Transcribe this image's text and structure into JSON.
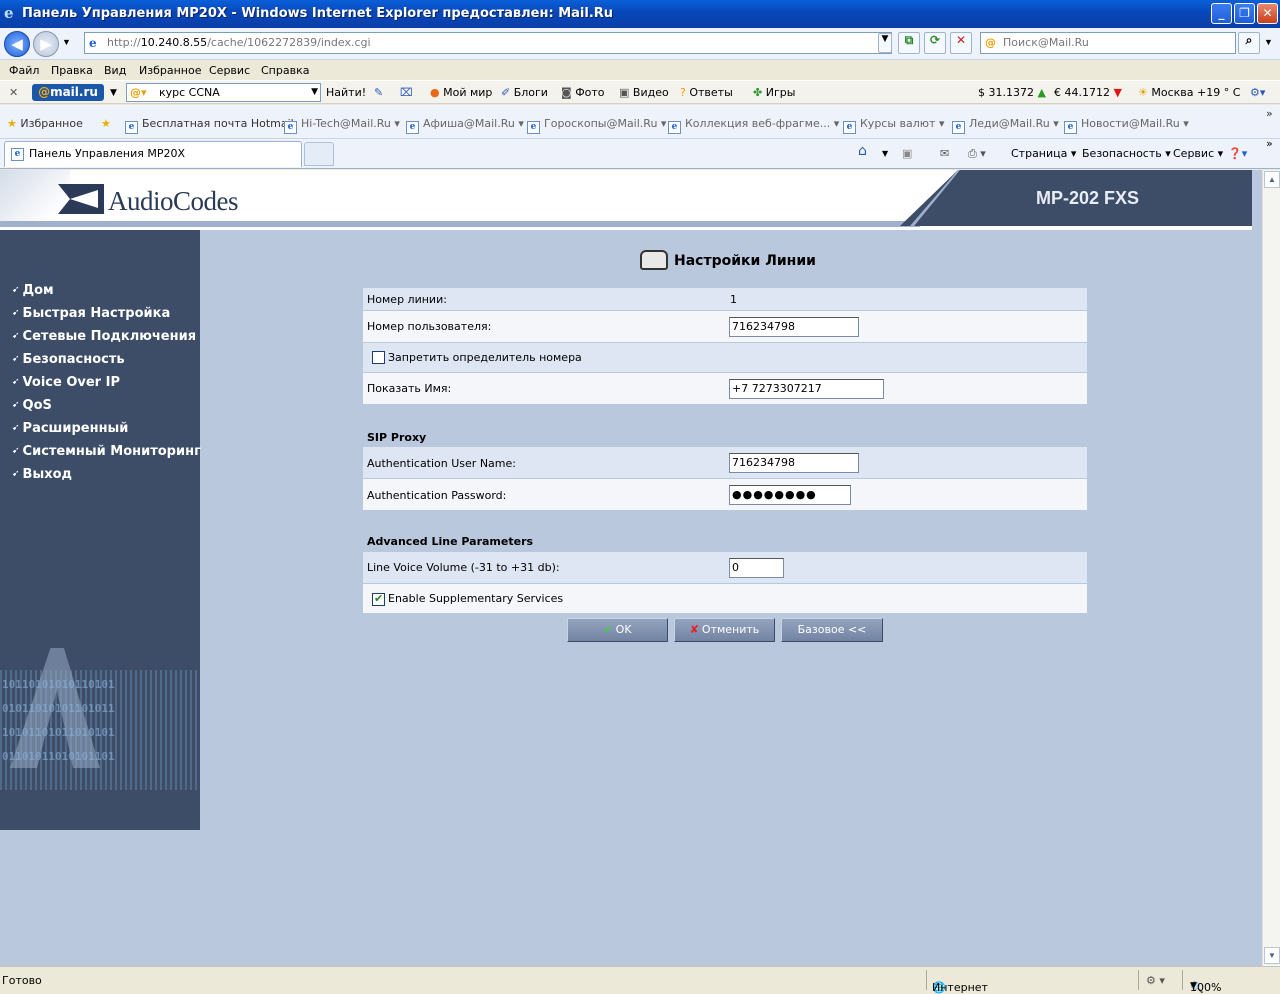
{
  "window": {
    "title": "Панель Управления MP20X - Windows Internet Explorer предоставлен: Mail.Ru"
  },
  "address": {
    "url_prefix": "http://",
    "url_host": "10.240.8.55",
    "url_path": "/cache/1062272839/index.cgi",
    "search_placeholder": "Поиск@Mail.Ru"
  },
  "menu": [
    "Файл",
    "Правка",
    "Вид",
    "Избранное",
    "Сервис",
    "Справка"
  ],
  "mailbar": {
    "logo_at": "@",
    "logo_text": "mail.ru",
    "search_value": "курс CCNA",
    "find": "Найти!",
    "items": [
      "Мой мир",
      "Блоги",
      "Фото",
      "Видео",
      "Ответы",
      "Игры"
    ],
    "usd": "$ 31.1372",
    "eur": "€ 44.1712",
    "weather": "Москва +19 ° C"
  },
  "favbar": {
    "favorites": "Избранное",
    "links": [
      "Бесплатная почта Hotmail",
      "Hi-Tech@Mail.Ru",
      "Афиша@Mail.Ru",
      "Гороскопы@Mail.Ru",
      "Коллекция веб-фрагме...",
      "Курсы валют",
      "Леди@Mail.Ru",
      "Новости@Mail.Ru"
    ]
  },
  "tabs": {
    "active": "Панель Управления MP20X",
    "commands": [
      "Страница",
      "Безопасность",
      "Сервис"
    ]
  },
  "header": {
    "logo": "AudioCodes",
    "model": "MP-202 FXS"
  },
  "sidebar": {
    "items": [
      "Дом",
      "Быстрая Настройка",
      "Сетевые Подключения",
      "Безопасность",
      "Voice Over IP",
      "QoS",
      "Расширенный",
      "Системный Мониторинг",
      "Выход"
    ],
    "deco_lines": [
      "10110101010110101",
      "01011010101101011",
      "10101101011010101",
      "01101011010101101"
    ]
  },
  "page": {
    "title": "Настройки Линии",
    "line_number_label": "Номер линии:",
    "line_number_value": "1",
    "user_number_label": "Номер пользователя:",
    "user_number_value": "716234798",
    "block_caller_id_label": "Запретить определитель номера",
    "block_caller_id": false,
    "display_name_label": "Показать Имя:",
    "display_name_value": "+7 7273307217",
    "sip_proxy_heading": "SIP Proxy",
    "auth_user_label": "Authentication User Name:",
    "auth_user_value": "716234798",
    "auth_pass_label": "Authentication Password:",
    "auth_pass_value": "●●●●●●●●",
    "advanced_heading": "Advanced Line Parameters",
    "volume_label": "Line Voice Volume (-31 to +31 db):",
    "volume_value": "0",
    "supp_services_label": "Enable Supplementary Services",
    "supp_services": true,
    "ok_mark": "✔",
    "ok_label": "OK",
    "cancel_mark": "✘",
    "cancel_label": "Отменить",
    "basic_label": "Базовое <<"
  },
  "status": {
    "left": "Готово",
    "zone": "Интернет",
    "zoom": "100%"
  }
}
